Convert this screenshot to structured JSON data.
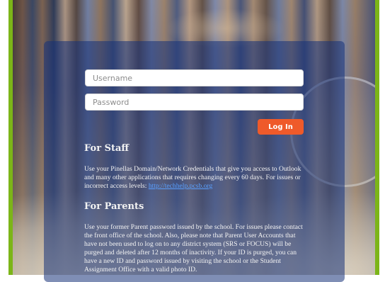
{
  "login": {
    "username_placeholder": "Username",
    "password_placeholder": "Password",
    "login_label": "Log In"
  },
  "staff": {
    "heading": "For Staff",
    "text": "Use your Pinellas Domain/Network Credentials that give you access to Outlook and many other applications that requires changing every 60 days. For issues or incorrect access levels: ",
    "link": "http://techhelp.pcsb.org"
  },
  "parents": {
    "heading": "For Parents",
    "text": "Use your former Parent password issued by the school. For issues please contact the front office of the school. Also, please note that Parent User Accounts that have not been used to log on to any district system (SRS or FOCUS) will be purged and deleted after 12 months of inactivity. If your ID is purged, you can have a new ID and password issued by visiting the school or the Student Assignment Office with a valid photo ID."
  },
  "colors": {
    "frame": "#7cb518",
    "login_button": "#ef5a2a",
    "panel": "#163278"
  }
}
